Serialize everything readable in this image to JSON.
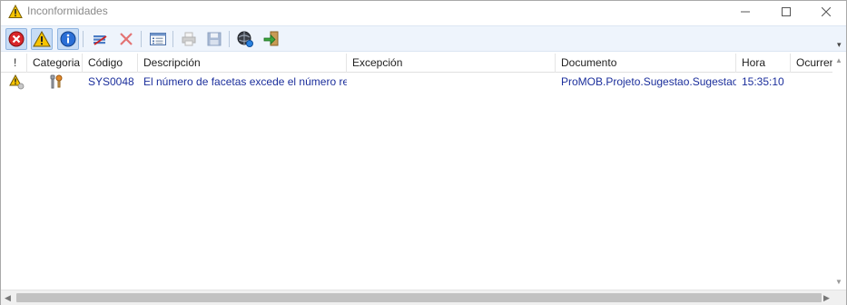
{
  "window": {
    "title": "Inconformidades",
    "icon": "warning-icon"
  },
  "toolbar": {
    "buttons": [
      {
        "icon": "error-icon"
      },
      {
        "icon": "warning-icon"
      },
      {
        "icon": "info-icon"
      },
      {
        "icon": "clear-list-icon"
      },
      {
        "icon": "delete-icon"
      },
      {
        "icon": "details-icon"
      },
      {
        "icon": "print-icon"
      },
      {
        "icon": "save-icon"
      },
      {
        "icon": "web-icon"
      },
      {
        "icon": "exit-icon"
      }
    ]
  },
  "table": {
    "columns": [
      "!",
      "Categoria",
      "Código",
      "Descripción",
      "Excepción",
      "Documento",
      "Hora",
      "Ocurrencias"
    ],
    "rows": [
      {
        "severity_icon": "warning-icon",
        "category_icon": "system-category-icon",
        "code": "SYS0048",
        "description": "El número de facetas excede el número recomendado",
        "exception": "",
        "document": "ProMOB.Projeto.Sugestao.Sugestao",
        "time": "15:35:10",
        "occurrences": ""
      }
    ]
  },
  "colors": {
    "text_link": "#1c2f9c",
    "toolbar_bg": "#eef4fc",
    "pressed_bg": "#c7dcf5"
  }
}
